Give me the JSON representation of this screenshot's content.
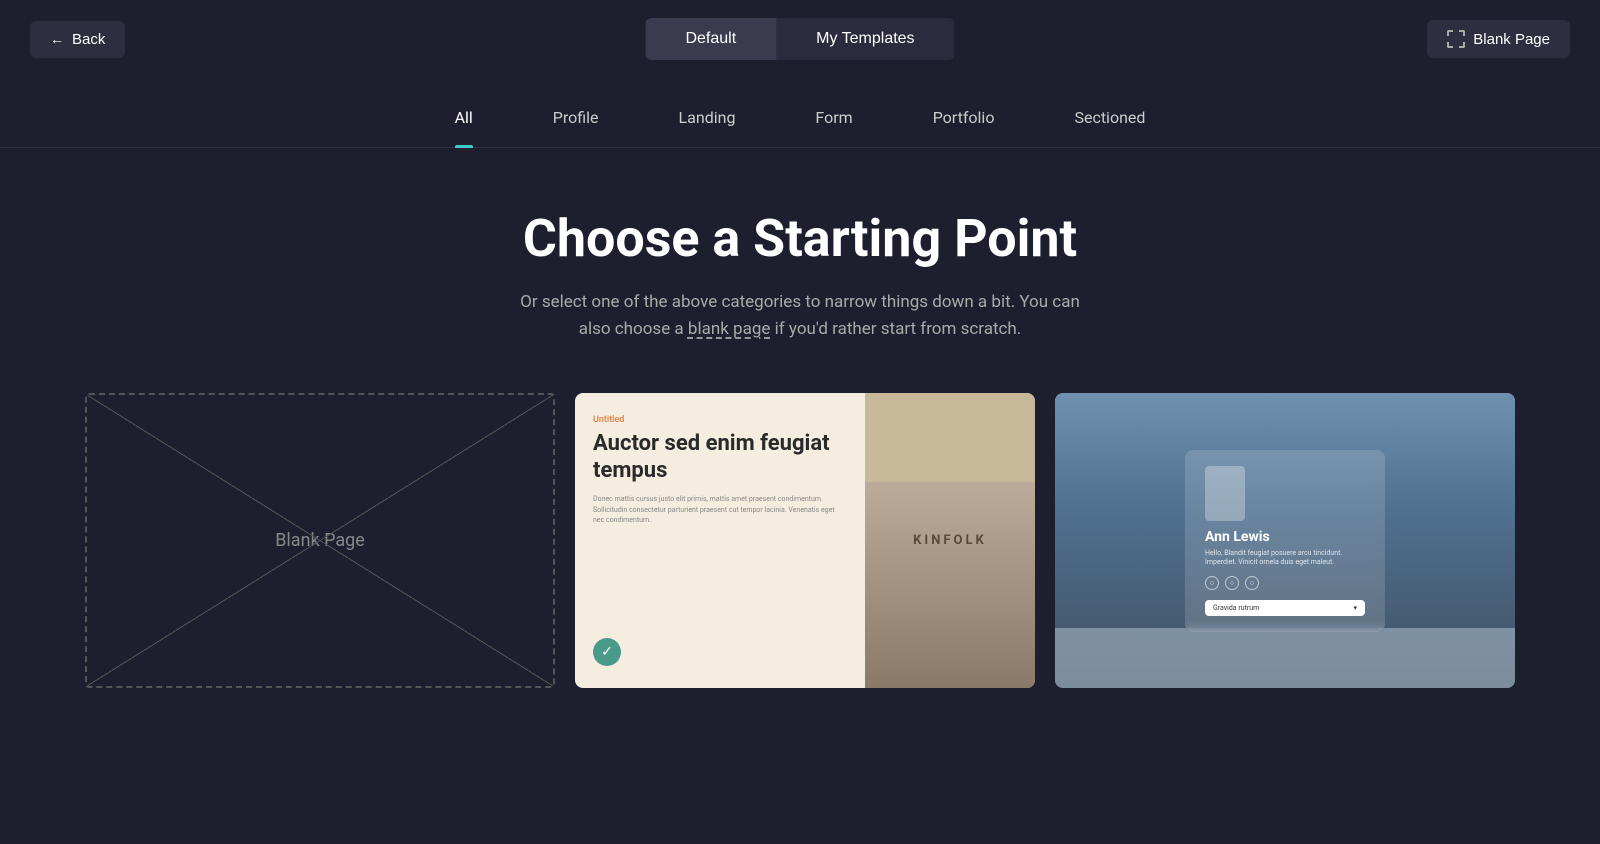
{
  "header": {
    "back_label": "Back",
    "tab_default": "Default",
    "tab_my_templates": "My Templates",
    "blank_page_label": "Blank Page"
  },
  "categories": {
    "items": [
      {
        "id": "all",
        "label": "All",
        "active": true
      },
      {
        "id": "profile",
        "label": "Profile",
        "active": false
      },
      {
        "id": "landing",
        "label": "Landing",
        "active": false
      },
      {
        "id": "form",
        "label": "Form",
        "active": false
      },
      {
        "id": "portfolio",
        "label": "Portfolio",
        "active": false
      },
      {
        "id": "sectioned",
        "label": "Sectioned",
        "active": false
      }
    ]
  },
  "hero": {
    "title": "Choose a Starting Point",
    "subtitle": "Or select one of the above categories to narrow things down a bit. You can also choose a blank page if you'd rather start from scratch."
  },
  "templates": {
    "blank": {
      "label": "Blank Page"
    },
    "landing": {
      "tag": "Untitled",
      "title": "Auctor sed enim feugiat tempus",
      "body": "Donec mattis cursus justo elit primis, mattis amet praesent condimentum. Sollicitudin consectetur parturient praesent cut tempor lacinia. Venenatis eget nec condimentum.",
      "book_title": "KINFOLK",
      "btn_icon": "✓"
    },
    "profile": {
      "name": "Ann Lewis",
      "description": "Hello, Blandit feugiat posuere arcu tincidunt. Imperdiet. Vinicit ornela duis eget maleut.",
      "cta_label": "Gravida rutrum",
      "icon1": "○",
      "icon2": "○",
      "icon3": "○"
    }
  }
}
